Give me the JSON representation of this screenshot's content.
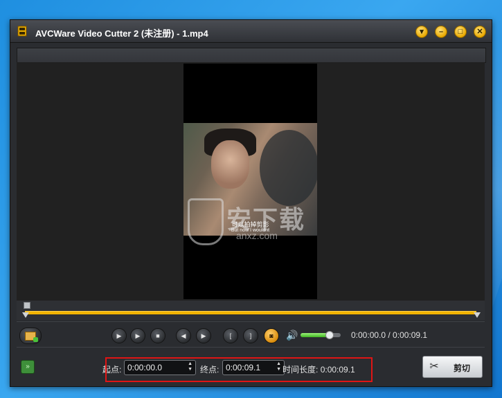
{
  "window": {
    "title": "AVCWare Video Cutter 2 (未注册) - 1.mp4",
    "controls": {
      "minimize_icon": "minimize-icon",
      "maximize_icon": "maximize-icon",
      "close_icon": "close-icon",
      "menu_icon": "dropdown-icon"
    }
  },
  "video": {
    "subtitle_cn": "可以拍掉剪影",
    "subtitle_en": "But now I wouldnt"
  },
  "watermark": {
    "text": "安下载",
    "url": "anxz.com"
  },
  "timeline": {
    "accent": "#f2b400",
    "position": 0.0
  },
  "playback": {
    "buttons": [
      "play-icon",
      "play-segment-icon",
      "stop-icon",
      "previous-frame-icon",
      "next-frame-icon",
      "set-start-icon",
      "set-end-icon",
      "snapshot-icon"
    ],
    "volume": 0.7,
    "time_display": "0:00:00.0 / 0:00:09.1"
  },
  "trim": {
    "start_label": "起点:",
    "start_value": "0:00:00.0",
    "end_label": "终点:",
    "end_value": "0:00:09.1",
    "duration_label": "时间长度:",
    "duration_value": "0:00:09.1"
  },
  "cut_button": {
    "label": "剪切"
  },
  "colors": {
    "accent": "#f2b400",
    "highlight": "#e01515",
    "volume": "#3fb522"
  }
}
